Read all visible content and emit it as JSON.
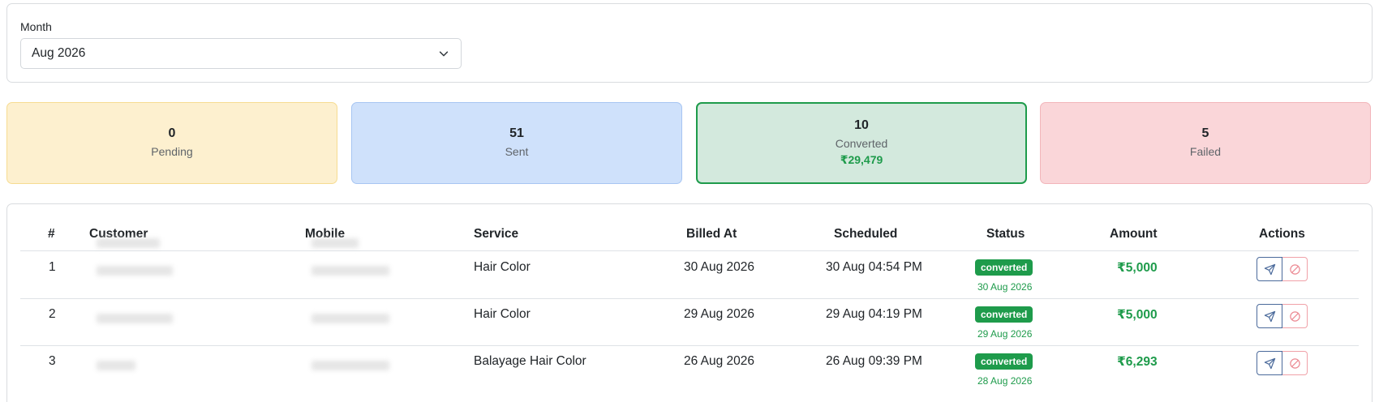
{
  "filter": {
    "label": "Month",
    "selected": "Aug 2026"
  },
  "stats": {
    "pending": {
      "count": "0",
      "label": "Pending"
    },
    "sent": {
      "count": "51",
      "label": "Sent"
    },
    "converted": {
      "count": "10",
      "label": "Converted",
      "amount": "₹29,479"
    },
    "failed": {
      "count": "5",
      "label": "Failed"
    }
  },
  "table": {
    "headers": [
      "#",
      "Customer",
      "Mobile",
      "Service",
      "Billed At",
      "Scheduled",
      "Status",
      "Amount",
      "Actions"
    ],
    "rows": [
      {
        "index": "1",
        "service": "Hair Color",
        "billed_at": "30 Aug 2026",
        "scheduled": "30 Aug 04:54 PM",
        "status": "converted",
        "status_date": "30 Aug 2026",
        "amount": "₹5,000"
      },
      {
        "index": "2",
        "service": "Hair Color",
        "billed_at": "29 Aug 2026",
        "scheduled": "29 Aug 04:19 PM",
        "status": "converted",
        "status_date": "29 Aug 2026",
        "amount": "₹5,000"
      },
      {
        "index": "3",
        "service": "Balayage Hair Color",
        "billed_at": "26 Aug 2026",
        "scheduled": "26 Aug 09:39 PM",
        "status": "converted",
        "status_date": "28 Aug 2026",
        "amount": "₹6,293"
      }
    ]
  },
  "colors": {
    "success": "#1e9b4b",
    "pending_bg": "#fdf0cf",
    "sent_bg": "#cfe1fb",
    "converted_bg": "#d3e9dd",
    "failed_bg": "#fad6d9"
  },
  "icons": {
    "select": "chevron-down-icon",
    "send": "send-icon",
    "cancel": "ban-icon"
  }
}
